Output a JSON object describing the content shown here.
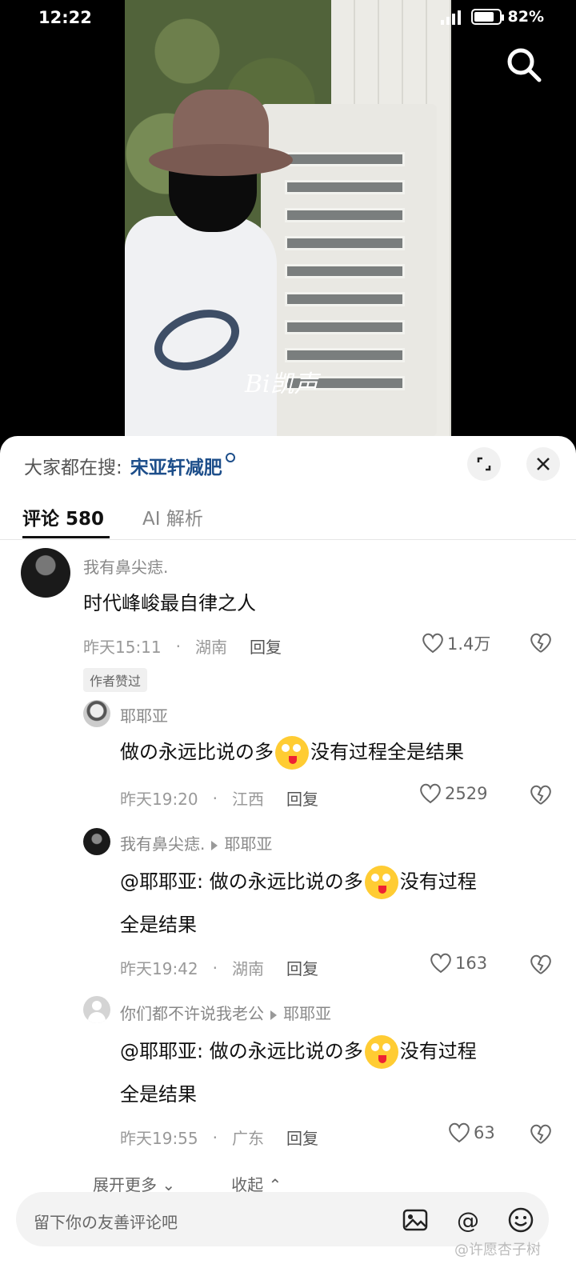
{
  "status": {
    "time": "12:22",
    "battery": "82%",
    "battery_level": 0.82
  },
  "video": {
    "watermark": "Bi凯声"
  },
  "sheet": {
    "search_label": "大家都在搜:",
    "search_term": "宋亚轩减肥",
    "tabs": {
      "comments": "评论 580",
      "ai": "AI 解析"
    }
  },
  "comments": [
    {
      "user": "我有鼻尖痣.",
      "text": "时代峰峻最自律之人",
      "time": "昨天15:11",
      "location": "湖南",
      "reply": "回复",
      "likes": "1.4万",
      "badge": "作者赞过"
    },
    {
      "user": "耶耶亚",
      "text_before": "做の永远比说の多",
      "text_after": "没有过程全是结果",
      "time": "昨天19:20",
      "location": "江西",
      "reply": "回复",
      "likes": "2529"
    },
    {
      "user": "我有鼻尖痣.",
      "to": "耶耶亚",
      "text_before": "@耶耶亚: 做の永远比说の多",
      "text_after": "没有过程",
      "text_line2": "全是结果",
      "time": "昨天19:42",
      "location": "湖南",
      "reply": "回复",
      "likes": "163"
    },
    {
      "user": "你们都不许说我老公",
      "to": "耶耶亚",
      "text_before": "@耶耶亚: 做の永远比说の多",
      "text_after": "没有过程",
      "text_line2": "全是结果",
      "time": "昨天19:55",
      "location": "广东",
      "reply": "回复",
      "likes": "63"
    }
  ],
  "controls": {
    "expand_more": "展开更多 ⌄",
    "collapse": "收起 ⌃"
  },
  "input": {
    "placeholder": "留下你の友善评论吧"
  },
  "watermark": "@许愿杏子树",
  "icons": [
    "search-icon",
    "expand-icon",
    "close-icon",
    "heart-icon",
    "dislike-icon",
    "image-icon",
    "at-icon",
    "emoji-icon"
  ]
}
